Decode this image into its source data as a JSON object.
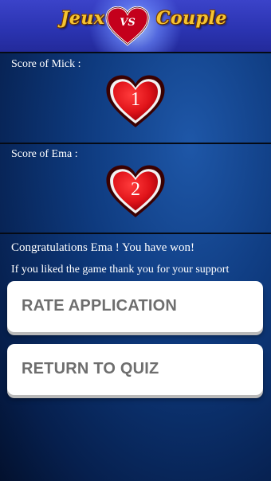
{
  "header": {
    "logo_left": "Jeux",
    "logo_center": "VS",
    "logo_right": "Couple"
  },
  "scores": [
    {
      "label": "Score of Mick :",
      "value": "1"
    },
    {
      "label": "Score of Ema :",
      "value": "2"
    }
  ],
  "result": {
    "message": "Congratulations Ema ! You have won!",
    "support_text": "If you liked the game thank you for your support"
  },
  "buttons": {
    "rate_label": "RATE APPLICATION",
    "return_label": "RETURN TO QUIZ"
  },
  "colors": {
    "heart_fill": "#e0141a",
    "heart_outline": "#5a0000",
    "logo_text": "#f5c431",
    "header_bg": "#2a33b0",
    "button_text": "#6e6e6e"
  },
  "icons": {
    "logo_heart": "heart-icon",
    "score_heart": "heart-icon"
  }
}
